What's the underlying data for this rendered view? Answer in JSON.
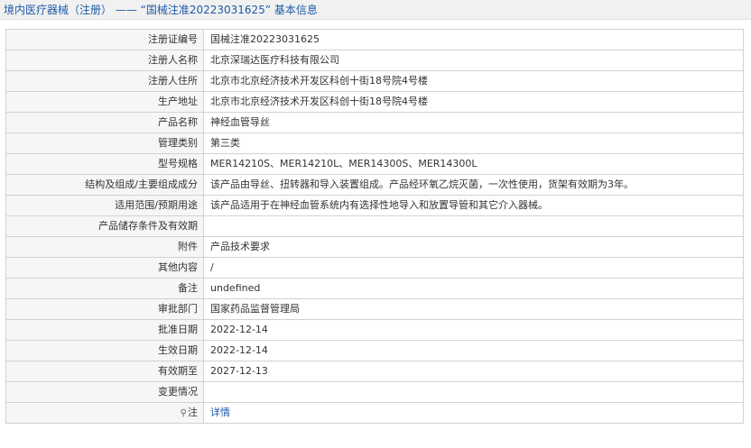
{
  "header": {
    "title": "境内医疗器械（注册） —— “国械注准20223031625” 基本信息"
  },
  "rows": [
    {
      "label": "注册证编号",
      "value": "国械注准20223031625"
    },
    {
      "label": "注册人名称",
      "value": "北京深瑞达医疗科技有限公司"
    },
    {
      "label": "注册人住所",
      "value": "北京市北京经济技术开发区科创十街18号院4号楼"
    },
    {
      "label": "生产地址",
      "value": "北京市北京经济技术开发区科创十街18号院4号楼"
    },
    {
      "label": "产品名称",
      "value": "神经血管导丝"
    },
    {
      "label": "管理类别",
      "value": "第三类"
    },
    {
      "label": "型号规格",
      "value": "MER14210S、MER14210L、MER14300S、MER14300L"
    },
    {
      "label": "结构及组成/主要组成成分",
      "value": "该产品由导丝、扭转器和导入装置组成。产品经环氧乙烷灭菌，一次性使用，货架有效期为3年。"
    },
    {
      "label": "适用范围/预期用途",
      "value": "该产品适用于在神经血管系统内有选择性地导入和放置导管和其它介入器械。"
    },
    {
      "label": "产品储存条件及有效期",
      "value": ""
    },
    {
      "label": "附件",
      "value": "产品技术要求"
    },
    {
      "label": "其他内容",
      "value": "/"
    },
    {
      "label": "备注",
      "value": "undefined"
    },
    {
      "label": "审批部门",
      "value": "国家药品监督管理局"
    },
    {
      "label": "批准日期",
      "value": "2022-12-14"
    },
    {
      "label": "生效日期",
      "value": "2022-12-14"
    },
    {
      "label": "有效期至",
      "value": "2027-12-13"
    },
    {
      "label": "变更情况",
      "value": ""
    }
  ],
  "note_row": {
    "icon": "pin-icon",
    "label": "注",
    "link_text": "详情"
  },
  "colors": {
    "title": "#1e5aa8",
    "link": "#1e5aa8",
    "label_bg": "#f6f6f6",
    "border": "#d2d2d2"
  }
}
